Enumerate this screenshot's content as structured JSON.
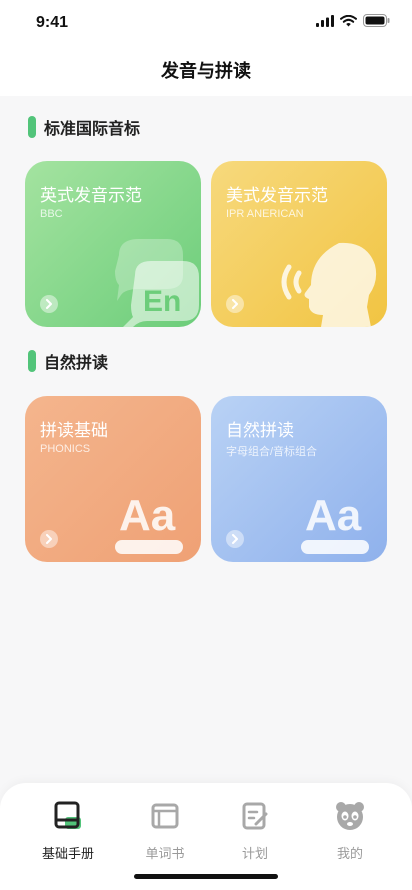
{
  "status_bar": {
    "time": "9:41"
  },
  "header": {
    "title": "发音与拼读"
  },
  "sections": [
    {
      "title": "标准国际音标",
      "cards": [
        {
          "title": "英式发音示范",
          "subtitle": "BBC",
          "icon": "en-speech-bubble-icon",
          "badge": "En",
          "gradient": [
            "#a4e3a0",
            "#6ccd7a"
          ]
        },
        {
          "title": "美式发音示范",
          "subtitle": "IPR ANERICAN",
          "icon": "speaking-head-icon",
          "gradient": [
            "#f7d97d",
            "#f1c442"
          ]
        }
      ]
    },
    {
      "title": "自然拼读",
      "cards": [
        {
          "title": "拼读基础",
          "subtitle": "PHONICS",
          "icon": "letters-aa-icon",
          "letters": "Aa",
          "gradient": [
            "#f4b58d",
            "#efa175"
          ]
        },
        {
          "title": "自然拼读",
          "subtitle": "字母组合/音标组合",
          "icon": "letters-aa-icon",
          "letters": "Aa",
          "gradient": [
            "#b9d2f5",
            "#8fb1ec"
          ]
        }
      ]
    }
  ],
  "bottom_nav": {
    "items": [
      {
        "label": "基础手册",
        "icon": "handbook-icon",
        "active": true
      },
      {
        "label": "单词书",
        "icon": "word-book-icon",
        "active": false
      },
      {
        "label": "计划",
        "icon": "plan-edit-icon",
        "active": false
      },
      {
        "label": "我的",
        "icon": "panda-profile-icon",
        "active": false
      }
    ]
  },
  "colors": {
    "accent": "#52c47a",
    "active_text": "#222222",
    "inactive_text": "#9a9a9a"
  }
}
